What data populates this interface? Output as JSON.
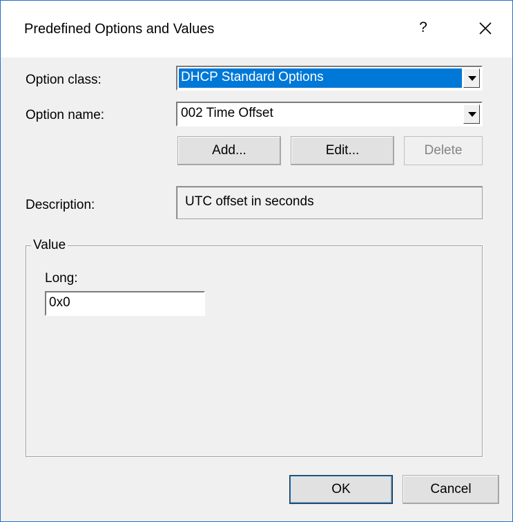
{
  "window": {
    "title": "Predefined Options and Values",
    "help_label": "?"
  },
  "option_class": {
    "label": "Option class:",
    "value": "DHCP Standard Options"
  },
  "option_name": {
    "label": "Option name:",
    "value": "002 Time Offset"
  },
  "buttons": {
    "add": "Add...",
    "edit": "Edit...",
    "delete": "Delete",
    "ok": "OK",
    "cancel": "Cancel"
  },
  "description": {
    "label": "Description:",
    "value": "UTC offset in seconds"
  },
  "value_group": {
    "legend": "Value",
    "field_label": "Long:",
    "field_value": "0x0"
  },
  "colors": {
    "selection": "#0078d7",
    "window_border": "#1e73c8",
    "dialog_background": "#f0f0f0"
  },
  "icons": {
    "help": "question-mark-icon",
    "close": "close-icon",
    "dropdown": "chevron-down-icon"
  }
}
